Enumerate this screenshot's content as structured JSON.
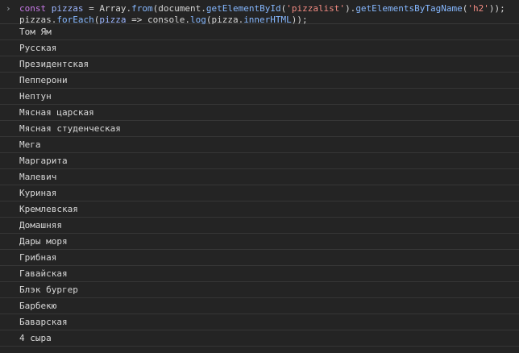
{
  "console": {
    "prompt_symbol": "›",
    "input": {
      "line1": {
        "const": "const",
        "var": "pizzas",
        "eq": " = ",
        "array": "Array.",
        "from": "from",
        "open": "(document.",
        "getById": "getElementById",
        "p1": "(",
        "str1": "'pizzalist'",
        "p2": ").",
        "getByTag": "getElementsByTagName",
        "p3": "(",
        "str2": "'h2'",
        "p4": "));"
      },
      "line2": {
        "obj": "pizzas.",
        "method": "forEach",
        "p1": "(",
        "param": "pizza",
        "arrow": " => console.",
        "log": "log",
        "rest": "(pizza.",
        "prop": "innerHTML",
        "end": "));"
      }
    },
    "outputs": [
      "Том Ям",
      "Русская",
      "Президентская",
      "Пепперони",
      "Нептун",
      "Мясная царская",
      "Мясная студенческая",
      "Мега",
      "Маргарита",
      "Малевич",
      "Куриная",
      "Кремлевская",
      "Домашняя",
      "Дары моря",
      "Грибная",
      "Гавайская",
      "Блэк бургер",
      "Барбекю",
      "Баварская",
      "4 сыра"
    ]
  }
}
